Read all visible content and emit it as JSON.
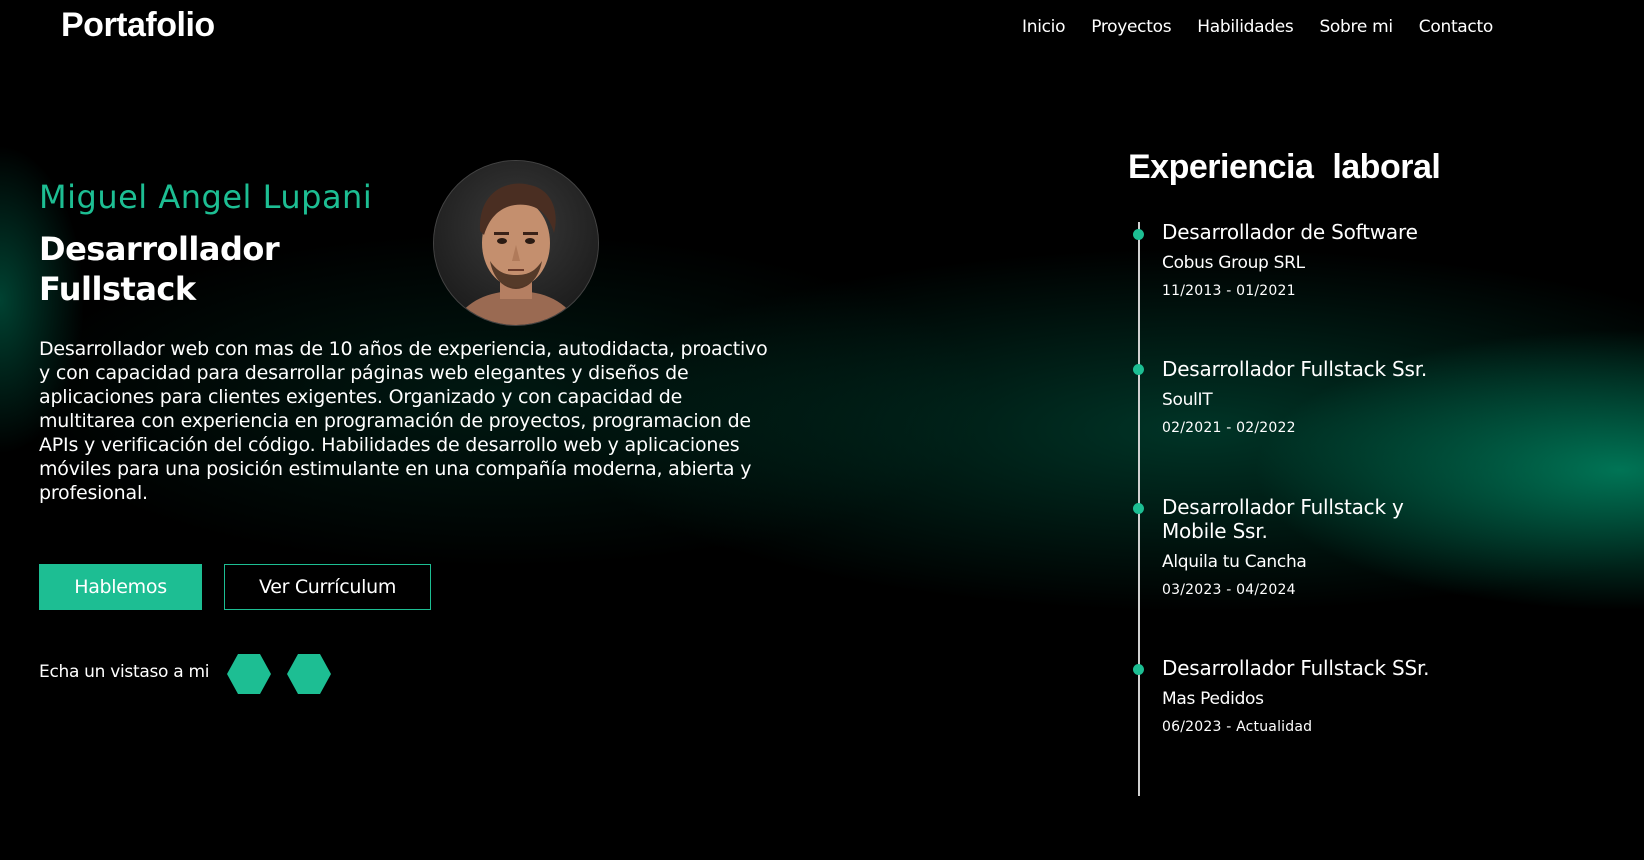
{
  "header": {
    "logo": "Portafolio",
    "nav": [
      "Inicio",
      "Proyectos",
      "Habilidades",
      "Sobre mi",
      "Contacto"
    ]
  },
  "hero": {
    "name": "Miguel Angel Lupani",
    "role": "Desarrollador Fullstack",
    "description": "Desarrollador web con mas de 10 años de experiencia, autodidacta, proactivo y con capacidad para desarrollar páginas web elegantes y diseños de aplicaciones para clientes exigentes. Organizado y con capacidad de multitarea con experiencia en programación de proyectos, programacion de APIs y verificación del código. Habilidades de desarrollo web y aplicaciones móviles para una posición estimulante en una compañía moderna, abierta y profesional.",
    "primary_button": "Hablemos",
    "secondary_button": "Ver Currículum",
    "social_label": "Echa un vistaso a mi"
  },
  "experience": {
    "title": "Experiencia laboral",
    "items": [
      {
        "role": "Desarrollador de Software",
        "company": "Cobus Group SRL",
        "dates": "11/2013 - 01/2021"
      },
      {
        "role": "Desarrollador Fullstack Ssr.",
        "company": "SoulIT",
        "dates": "02/2021 - 02/2022"
      },
      {
        "role": "Desarrollador Fullstack y Mobile Ssr.",
        "company": "Alquila tu Cancha",
        "dates": "03/2023 - 04/2024"
      },
      {
        "role": "Desarrollador Fullstack SSr.",
        "company": "Mas Pedidos",
        "dates": "06/2023 - Actualidad"
      }
    ]
  },
  "colors": {
    "accent": "#1dbe93",
    "background": "#000000",
    "glow": "#00966e"
  },
  "icons": {
    "social_1": "hexagon-social-icon",
    "social_2": "hexagon-social-icon"
  }
}
